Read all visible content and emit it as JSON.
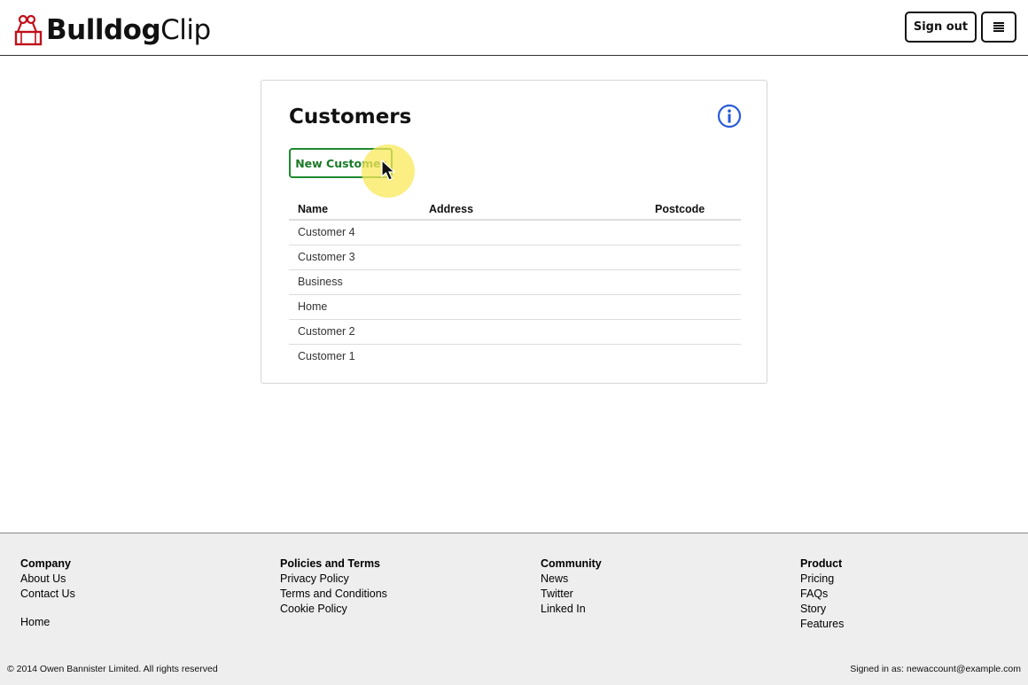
{
  "header": {
    "logo_bold": "Bulldog",
    "logo_light": "Clip",
    "signout_label": "Sign out",
    "menu_icon": "hamburger-icon",
    "brand_color": "#c0101a"
  },
  "card": {
    "title": "Customers",
    "info_icon": "info-icon",
    "new_button_label": "New Customer",
    "table": {
      "headers": [
        "Name",
        "Address",
        "Postcode"
      ],
      "rows": [
        {
          "name": "Customer 4",
          "address": "",
          "postcode": ""
        },
        {
          "name": "Customer 3",
          "address": "",
          "postcode": ""
        },
        {
          "name": "Business",
          "address": "",
          "postcode": ""
        },
        {
          "name": "Home",
          "address": "",
          "postcode": ""
        },
        {
          "name": "Customer 2",
          "address": "",
          "postcode": ""
        },
        {
          "name": "Customer 1",
          "address": "",
          "postcode": ""
        }
      ]
    }
  },
  "footer": {
    "columns": [
      {
        "heading": "Company",
        "links": [
          "About Us",
          "Contact Us"
        ],
        "extra": "Home"
      },
      {
        "heading": "Policies and Terms",
        "links": [
          "Privacy Policy",
          "Terms and Conditions",
          "Cookie Policy"
        ]
      },
      {
        "heading": "Community",
        "links": [
          "News",
          "Twitter",
          "Linked In"
        ]
      },
      {
        "heading": "Product",
        "links": [
          "Pricing",
          "FAQs",
          "Story",
          "Features"
        ]
      }
    ],
    "copyright": "© 2014 Owen Bannister Limited. All rights reserved",
    "signed_in": "Signed in as: newaccount@example.com"
  },
  "colors": {
    "accent_green": "#1e8a2e",
    "info_blue": "#2a5bd7",
    "footer_bg": "#eeeeee"
  }
}
